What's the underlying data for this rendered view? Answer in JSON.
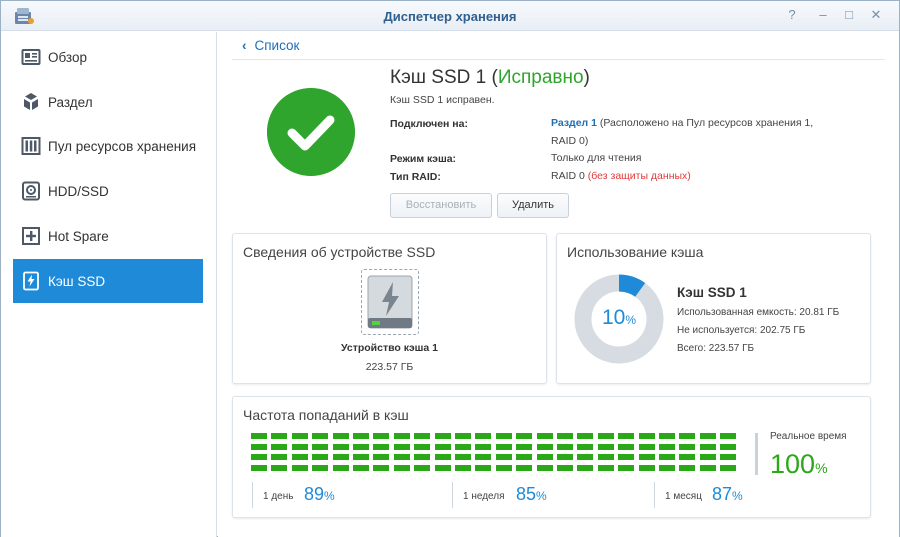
{
  "window": {
    "title": "Диспетчер хранения",
    "controls": [
      "?",
      "–",
      "□",
      "✕"
    ]
  },
  "sidebar": {
    "items": [
      {
        "label": "Обзор",
        "icon": "overview-icon",
        "active": false
      },
      {
        "label": "Раздел",
        "icon": "volume-icon",
        "active": false
      },
      {
        "label": "Пул ресурсов хранения",
        "icon": "storage-pool-icon",
        "active": false
      },
      {
        "label": "HDD/SSD",
        "icon": "disk-icon",
        "active": false
      },
      {
        "label": "Hot Spare",
        "icon": "hot-spare-icon",
        "active": false
      },
      {
        "label": "Кэш SSD",
        "icon": "ssd-cache-icon",
        "active": true
      }
    ]
  },
  "main": {
    "back_label": "Список",
    "cache": {
      "name": "Кэш SSD 1",
      "status": "Исправно",
      "status_line": "Кэш SSD 1 исправен.",
      "connected_label": "Подключен на:",
      "connected_volume": "Раздел 1",
      "connected_detail": "(Расположено на Пул ресурсов хранения 1, RAID 0)",
      "mode_label": "Режим кэша:",
      "mode_value": "Только для чтения",
      "raid_label": "Тип RAID:",
      "raid_value": "RAID 0",
      "raid_note": "(без защиты данных)"
    },
    "buttons": {
      "restore": "Восстановить",
      "delete": "Удалить"
    },
    "device_panel": {
      "title": "Сведения об устройстве SSD",
      "device_name": "Устройство кэша 1",
      "device_size": "223.57 ГБ"
    },
    "usage_panel": {
      "title": "Использование кэша",
      "percent": "10",
      "percent_unit": "%",
      "percent_value": 0.1,
      "cache_name": "Кэш SSD 1",
      "used": "Использованная емкость: 20.81 ГБ",
      "unused": "Не используется: 202.75 ГБ",
      "total": "Всего: 223.57 ГБ"
    },
    "hit_panel": {
      "title": "Частота попаданий в кэш",
      "realtime_label": "Реальное время",
      "realtime_value": "100",
      "realtime_unit": "%",
      "periods": [
        {
          "label": "1 день",
          "value": "89",
          "unit": "%"
        },
        {
          "label": "1 неделя",
          "value": "85",
          "unit": "%"
        },
        {
          "label": "1 месяц",
          "value": "87",
          "unit": "%"
        }
      ]
    }
  },
  "colors": {
    "accent": "#1f8ad8",
    "ok_green": "#2da52a",
    "warning_red": "#e03b3b",
    "usage_ring": "#d6dce2"
  }
}
